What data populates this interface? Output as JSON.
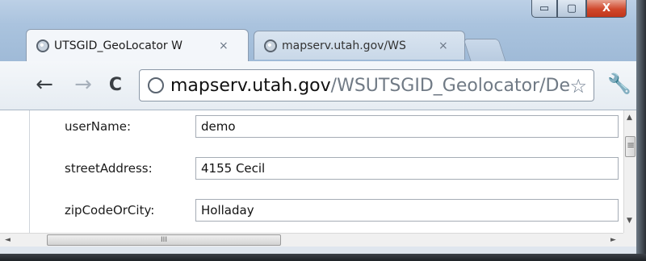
{
  "window": {
    "controls": {
      "minimize": "▭",
      "maximize": "▢",
      "close": "X"
    }
  },
  "tabs": [
    {
      "title": "UTSGID_GeoLocator W",
      "close": "×",
      "active": true
    },
    {
      "title": "mapserv.utah.gov/WS",
      "close": "×",
      "active": false
    }
  ],
  "toolbar": {
    "back": "←",
    "forward": "→",
    "reload": "C",
    "url_host": "mapserv.utah.gov",
    "url_path": "/WSUTSGID_Geolocator/De",
    "bookmark_icon": "star-icon",
    "menu_icon": "wrench-icon"
  },
  "form": {
    "fields": [
      {
        "label": "userName:",
        "value": "demo"
      },
      {
        "label": "streetAddress:",
        "value": "4155 Cecil"
      },
      {
        "label": "zipCodeOrCity:",
        "value": "Holladay"
      }
    ]
  },
  "scrollbars": {
    "up_arrow": "▲",
    "down_arrow": "▼",
    "left_arrow": "◄",
    "right_arrow": "►",
    "h_grip": "III",
    "v_grip": "≡"
  }
}
